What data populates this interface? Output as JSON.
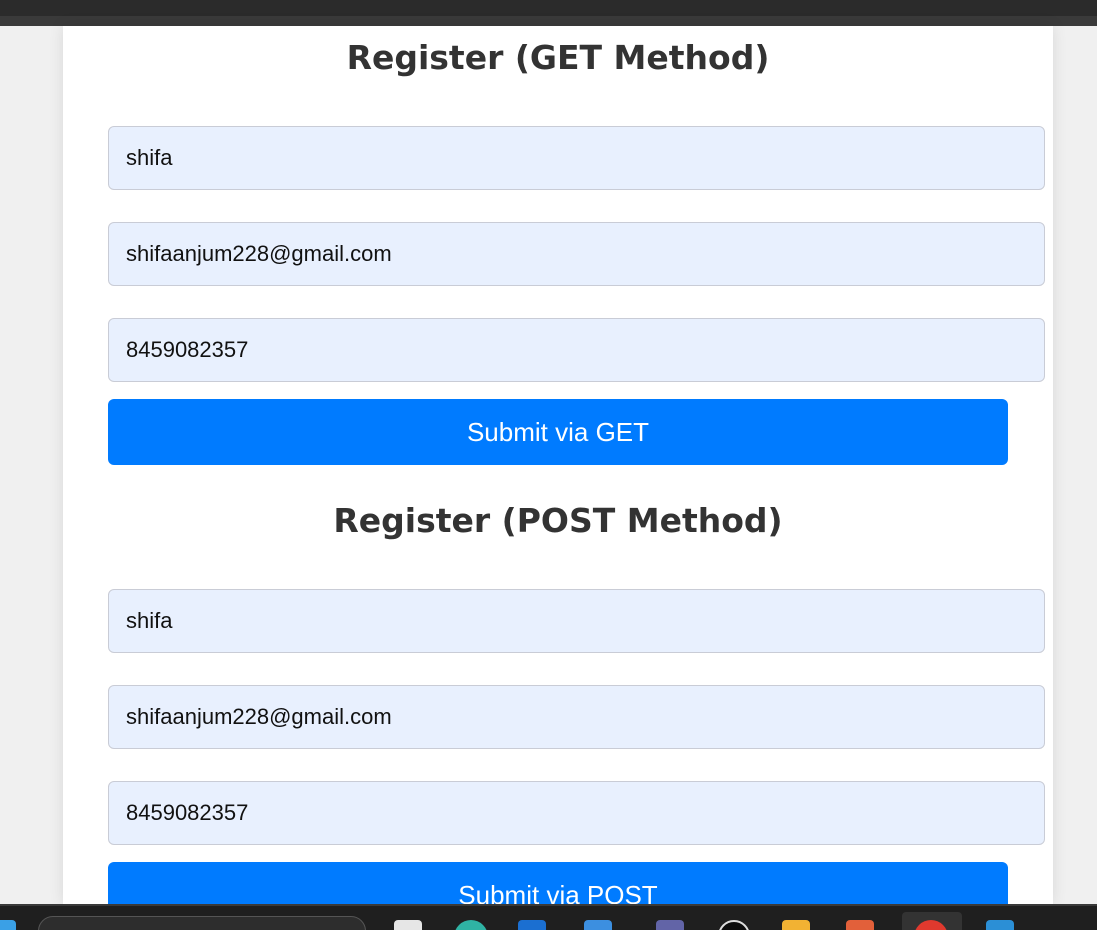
{
  "get_form": {
    "title": "Register (GET Method)",
    "name_value": "shifa",
    "email_value": "shifaanjum228@gmail.com",
    "phone_value": "8459082357",
    "submit_label": "Submit via GET"
  },
  "post_form": {
    "title": "Register (POST Method)",
    "name_value": "shifa",
    "email_value": "shifaanjum228@gmail.com",
    "phone_value": "8459082357",
    "submit_label": "Submit via POST"
  },
  "colors": {
    "button": "#007bff",
    "field_bg": "#e8f0fe",
    "heading": "#333333"
  },
  "taskbar": {
    "icons": [
      "windows-start-icon",
      "search-box",
      "notepad-icon",
      "edge-icon",
      "store-icon",
      "outlook-icon",
      "teams-icon",
      "github-icon",
      "file-explorer-icon",
      "office-icon",
      "chrome-icon",
      "vscode-icon"
    ]
  }
}
